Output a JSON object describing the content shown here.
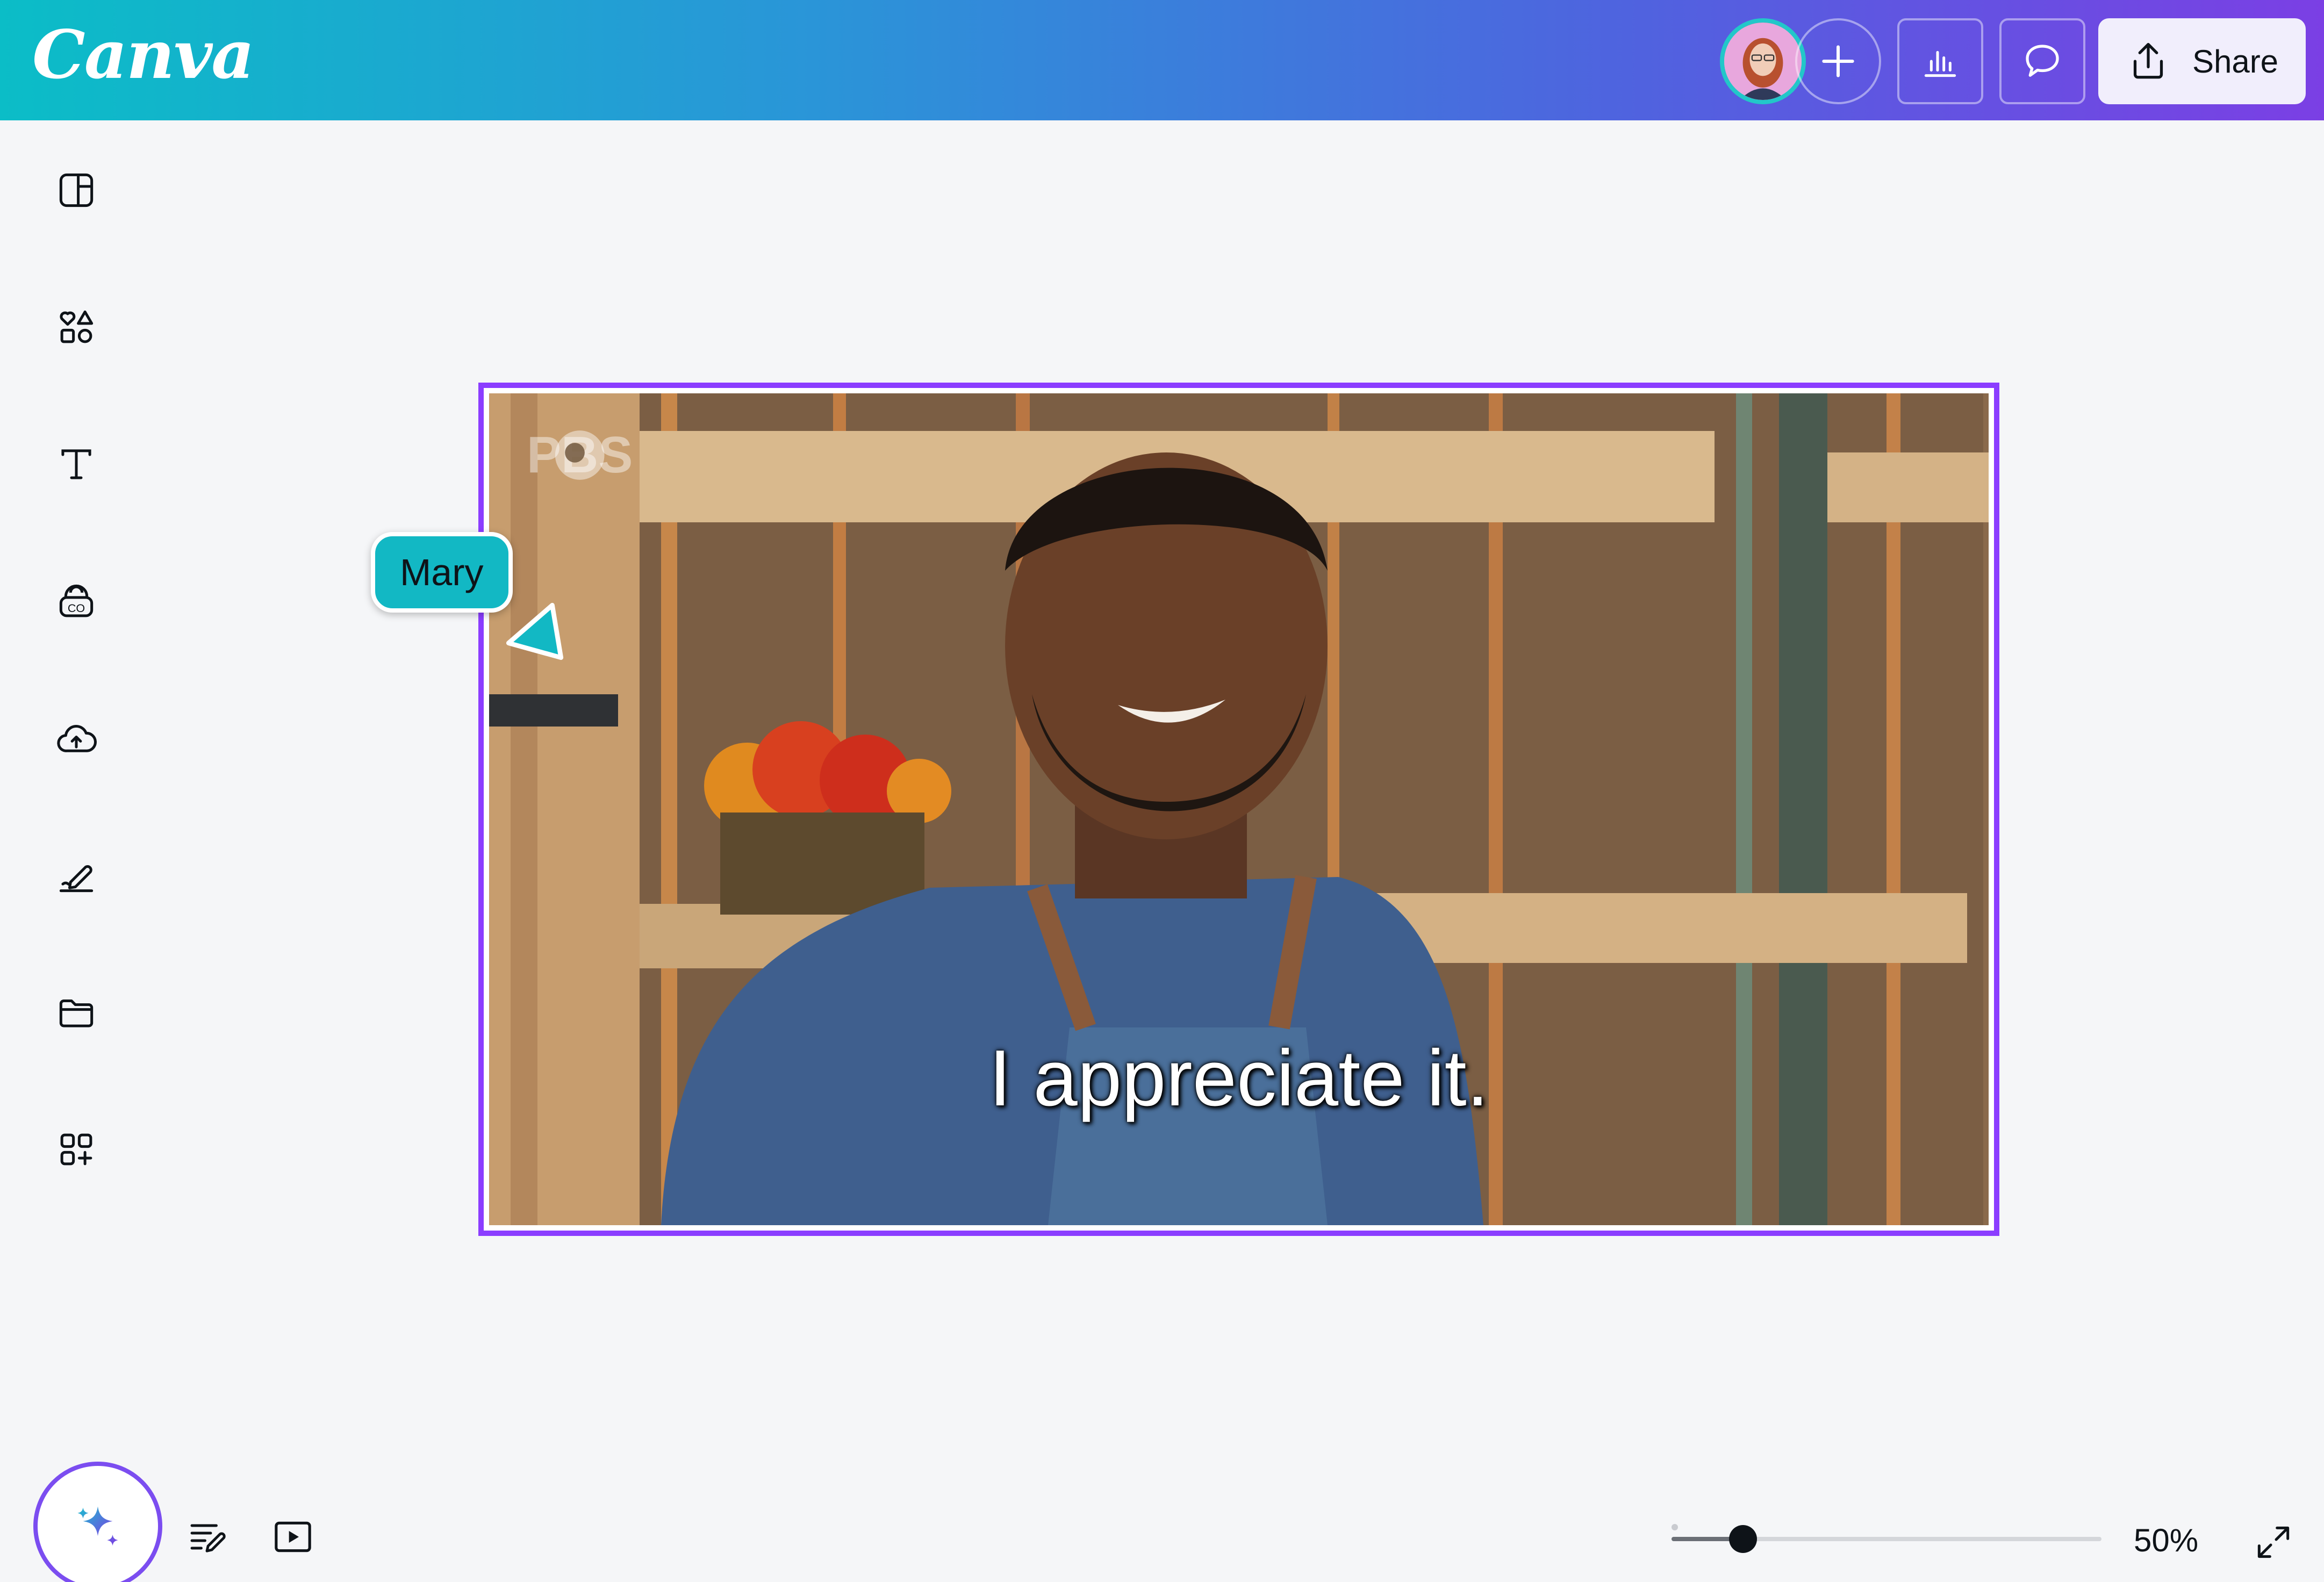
{
  "app": {
    "logo_text": "Canva"
  },
  "header": {
    "share_label": "Share",
    "icons": [
      "avatar",
      "plus-icon",
      "analytics-icon",
      "comment-icon",
      "share-icon"
    ]
  },
  "sidebar": {
    "items": [
      {
        "name": "design",
        "icon": "layout-icon"
      },
      {
        "name": "elements",
        "icon": "shapes-icon"
      },
      {
        "name": "text",
        "icon": "text-icon"
      },
      {
        "name": "brand",
        "icon": "brand-kit-icon"
      },
      {
        "name": "uploads",
        "icon": "cloud-upload-icon"
      },
      {
        "name": "draw",
        "icon": "draw-icon"
      },
      {
        "name": "projects",
        "icon": "folder-icon"
      },
      {
        "name": "apps",
        "icon": "apps-icon"
      }
    ],
    "magic_icon": "magic-sparkle-icon"
  },
  "canvas": {
    "watermark": "PBS",
    "subtitle": "I appreciate it.",
    "collaborator_cursor": {
      "name": "Mary",
      "color": "#12B8C4"
    },
    "selection_color": "#8B3DFF"
  },
  "footer": {
    "notes_icon": "notes-icon",
    "present_icon": "play-icon",
    "zoom_level": 50,
    "zoom_label": "50%",
    "fullscreen_icon": "expand-icon"
  },
  "colors": {
    "topbar_start": "#0BBDC7",
    "topbar_end": "#7B3FE4",
    "canvas_background": "#F5F6F8"
  }
}
